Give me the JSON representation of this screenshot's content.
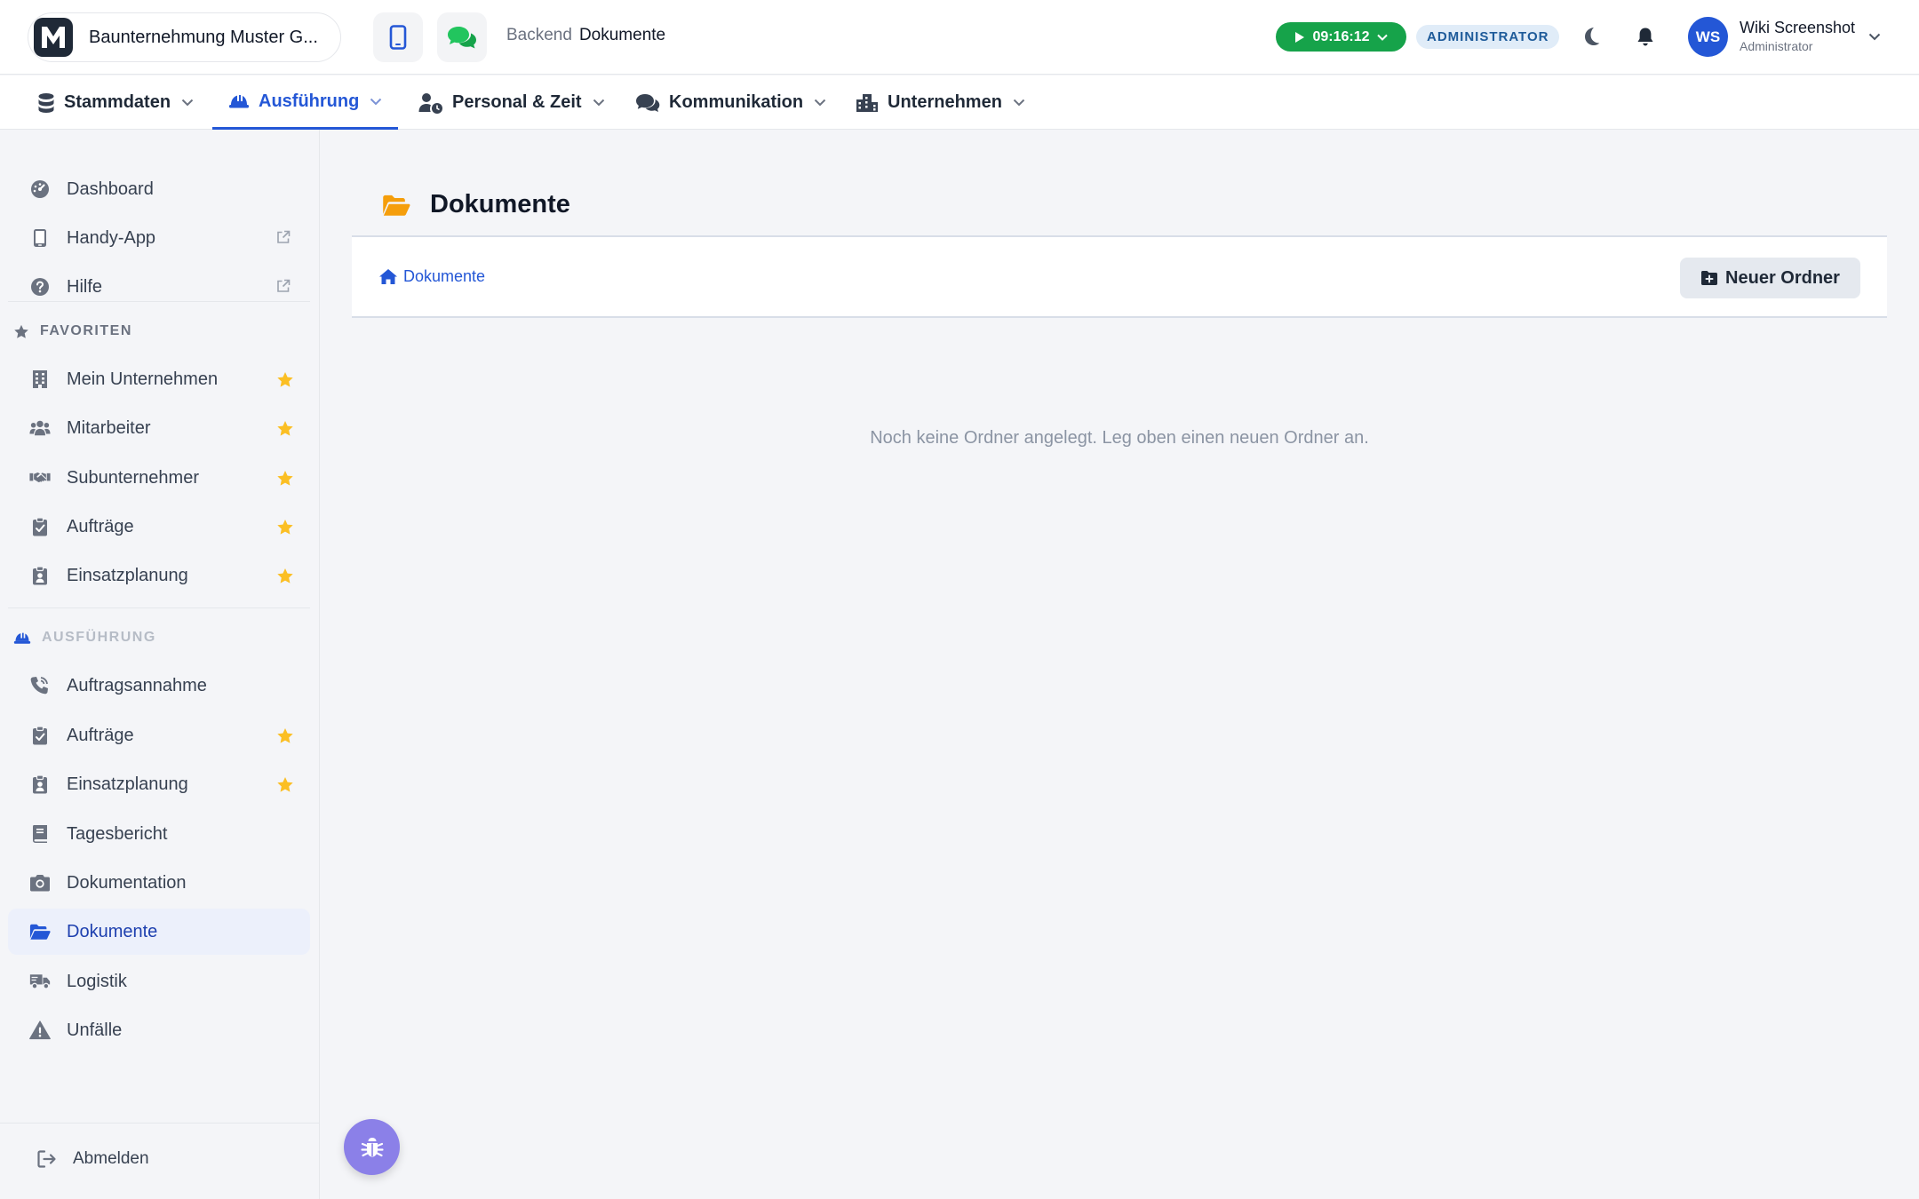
{
  "header": {
    "company_logo_letter": "M",
    "company_name": "Baunternehmung Muster G...",
    "breadcrumb_prefix": "Backend",
    "breadcrumb_current": "Dokumente",
    "timer": "09:16:12",
    "role_badge": "ADMINISTRATOR",
    "user_initials": "WS",
    "user_name": "Wiki Screenshot",
    "user_role": "Administrator"
  },
  "mainnav": {
    "items": [
      {
        "label": "Stammdaten",
        "icon": "database-icon"
      },
      {
        "label": "Ausführung",
        "icon": "hardhat-icon",
        "active": true
      },
      {
        "label": "Personal & Zeit",
        "icon": "user-clock-icon"
      },
      {
        "label": "Kommunikation",
        "icon": "comments-icon"
      },
      {
        "label": "Unternehmen",
        "icon": "city-icon"
      }
    ]
  },
  "sidebar": {
    "top_items": [
      {
        "label": "Dashboard",
        "icon": "dashboard-icon"
      },
      {
        "label": "Handy-App",
        "icon": "mobile-icon",
        "external": true
      },
      {
        "label": "Hilfe",
        "icon": "help-icon",
        "external": true
      }
    ],
    "favorites_title": "FAVORITEN",
    "favorites": [
      {
        "label": "Mein Unternehmen",
        "icon": "building-icon"
      },
      {
        "label": "Mitarbeiter",
        "icon": "users-icon"
      },
      {
        "label": "Subunternehmer",
        "icon": "handshake-icon"
      },
      {
        "label": "Aufträge",
        "icon": "clipboard-check-icon"
      },
      {
        "label": "Einsatzplanung",
        "icon": "clipboard-user-icon"
      }
    ],
    "section_title": "AUSFÜHRUNG",
    "section_items": [
      {
        "label": "Auftragsannahme",
        "icon": "phone-icon"
      },
      {
        "label": "Aufträge",
        "icon": "clipboard-check-icon",
        "starred": true
      },
      {
        "label": "Einsatzplanung",
        "icon": "clipboard-user-icon",
        "starred": true
      },
      {
        "label": "Tagesbericht",
        "icon": "book-icon"
      },
      {
        "label": "Dokumentation",
        "icon": "camera-icon"
      },
      {
        "label": "Dokumente",
        "icon": "folder-open-icon",
        "active": true
      },
      {
        "label": "Logistik",
        "icon": "truck-icon"
      },
      {
        "label": "Unfälle",
        "icon": "warning-icon"
      }
    ],
    "logout_label": "Abmelden"
  },
  "content": {
    "title": "Dokumente",
    "breadcrumb_home": "Dokumente",
    "new_folder_label": "Neuer Ordner",
    "empty_message": "Noch keine Ordner angelegt. Leg oben einen neuen Ordner an."
  },
  "colors": {
    "accent": "#2457d6",
    "timer_green": "#16a34a",
    "star": "#fbbf24",
    "folder": "#f59e0b",
    "fab": "#8b80e8"
  }
}
